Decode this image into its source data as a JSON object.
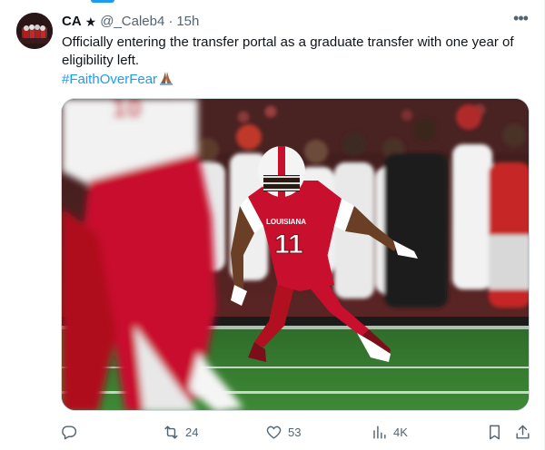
{
  "tweet": {
    "author_name": "CA",
    "badge": "★",
    "handle": "@_Caleb4",
    "separator": "·",
    "time": "15h",
    "more_label": "•••",
    "text": "Officially entering the transfer portal as a graduate transfer with one year of eligibility left.",
    "hashtag": "#FaithOverFear",
    "emoji_icon": "folded-hands-emoji"
  },
  "media": {
    "jersey_number": "11",
    "jersey_text": "LOUISIANA",
    "blurred_number": "10",
    "colors": {
      "jersey_red": "#c8102e",
      "field_green": "#2e7d32"
    }
  },
  "actions": {
    "reply_icon": "reply-icon",
    "retweet_icon": "retweet-icon",
    "retweet_count": "24",
    "like_icon": "heart-icon",
    "like_count": "53",
    "views_icon": "views-chart-icon",
    "views_count": "4K",
    "bookmark_icon": "bookmark-icon",
    "share_icon": "share-icon"
  },
  "accent_color": "#1d9bf0"
}
